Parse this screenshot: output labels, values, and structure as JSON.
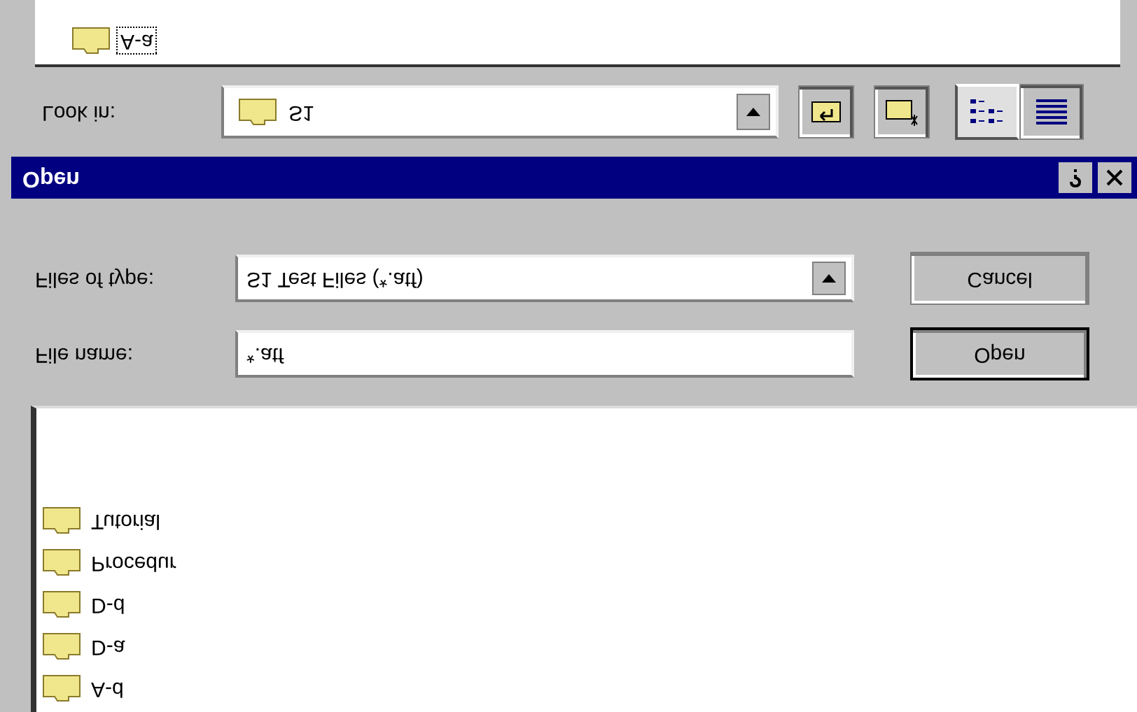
{
  "upper_list": {
    "items": [
      {
        "label": "A-a",
        "selected": true
      }
    ]
  },
  "look_in": {
    "label": "Look in:",
    "value": "S1",
    "views": [
      {
        "kind": "list",
        "selected": true
      },
      {
        "kind": "details",
        "selected": false
      }
    ]
  },
  "window": {
    "title": "Open"
  },
  "files_of_type": {
    "label": "Files of type:",
    "value": "S1 Test Files (*.atf)"
  },
  "file_name": {
    "label": "File name:",
    "value": "*.atf"
  },
  "buttons": [
    {
      "label": "Cancel",
      "default": false
    },
    {
      "label": "Open",
      "default": true
    }
  ],
  "lower_list": {
    "items": [
      {
        "label": "Tutorial",
        "selected": false
      },
      {
        "label": "Procedur",
        "selected": false
      },
      {
        "label": "D-d",
        "selected": false
      },
      {
        "label": "D-a",
        "selected": false
      },
      {
        "label": "A-d",
        "selected": false
      }
    ]
  }
}
